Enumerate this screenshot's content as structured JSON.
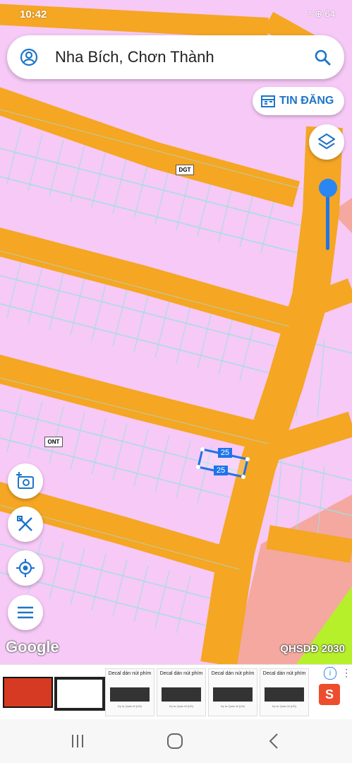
{
  "status_bar": {
    "time": "10:42",
    "icons": "⁵ ⊕ 64"
  },
  "search": {
    "title": "Nha Bích, Chơn Thành"
  },
  "tin_dang": {
    "label": "TIN ĐĂNG"
  },
  "map": {
    "labels": {
      "dgt": "DGT",
      "onk": "ONT",
      "lot_top": "25",
      "lot_bottom": "25"
    },
    "attribution": "Google",
    "layer_name": "QHSDĐ 2030"
  },
  "ads": {
    "cards": [
      {
        "title": "Decal dán nút phím",
        "sub": "Ký tự Quốc tế (US)"
      },
      {
        "title": "Decal dán nút phím",
        "sub": "Ký tự Quốc tế (US)"
      },
      {
        "title": "Decal dán nút phím",
        "sub": "Ký tự Quốc tế (US)"
      },
      {
        "title": "Decal dán nút phím",
        "sub": "Ký tự Quốc tế (US)"
      }
    ],
    "info": "i",
    "shop": "S"
  },
  "colors": {
    "road": "#f5a623",
    "parcel": "#f6c9f6",
    "grid": "#9fe0e0",
    "green": "#b6f02a",
    "salmon": "#f4a8a0",
    "accent": "#1e74c8"
  }
}
